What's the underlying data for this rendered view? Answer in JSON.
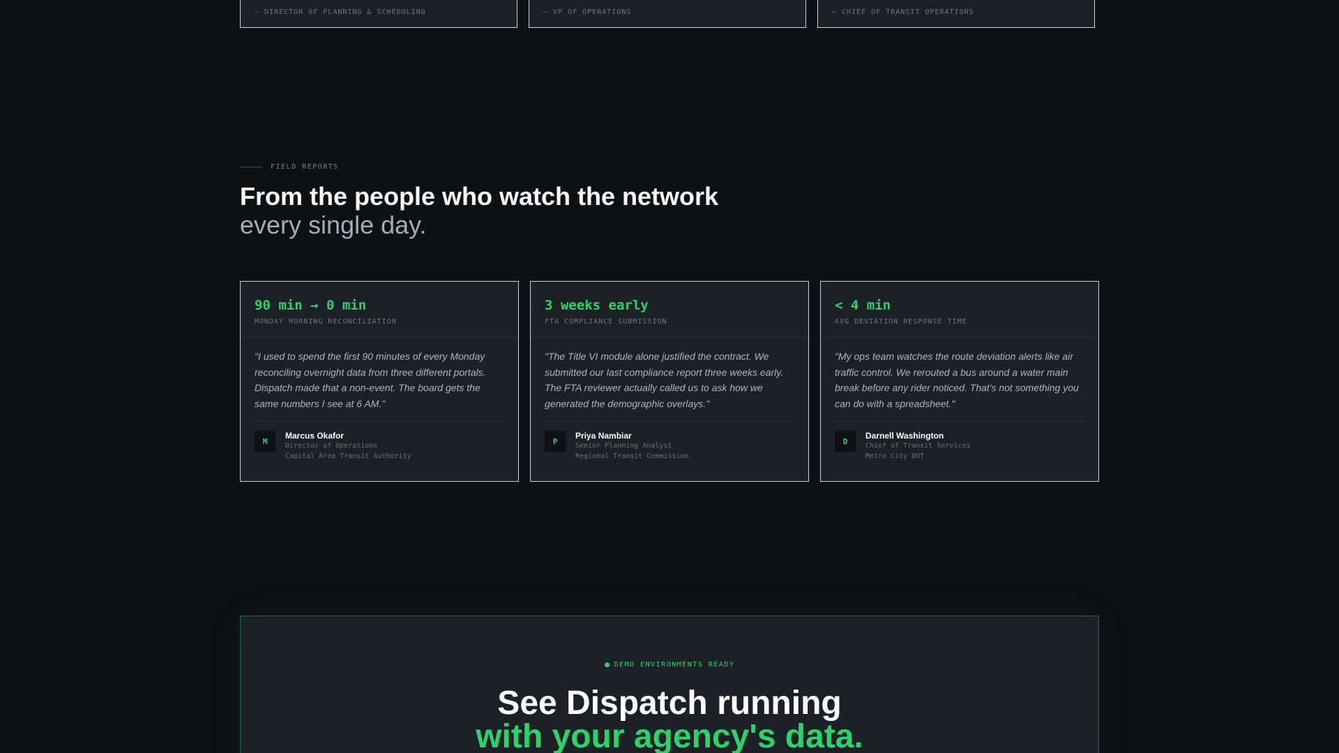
{
  "top_cards": [
    {
      "role": "— DIRECTOR OF PLANNING & SCHEDULING"
    },
    {
      "role": "— VP OF OPERATIONS"
    },
    {
      "role": "— CHIEF OF TRANSIT OPERATIONS"
    }
  ],
  "field_reports": {
    "eyebrow": "FIELD REPORTS",
    "headline": "From the people who watch the network",
    "headline_sub": "every single day.",
    "cards": [
      {
        "metric": "90 min → 0 min",
        "metric_label": "MONDAY MORNING RECONCILIATION",
        "quote": "\"I used to spend the first 90 minutes of every Monday reconciling overnight data from three different portals. Dispatch made that a non-event. The board gets the same numbers I see at 6 AM.\"",
        "avatar_initial": "M",
        "name": "Marcus Okafor",
        "title": "Director of Operations",
        "org": "Capital Area Transit Authority"
      },
      {
        "metric": "3 weeks early",
        "metric_label": "FTA COMPLIANCE SUBMISSION",
        "quote": "\"The Title VI module alone justified the contract. We submitted our last compliance report three weeks early. The FTA reviewer actually called us to ask how we generated the demographic overlays.\"",
        "avatar_initial": "P",
        "name": "Priya Nambiar",
        "title": "Senior Planning Analyst",
        "org": "Regional Transit Commission"
      },
      {
        "metric": "< 4 min",
        "metric_label": "AVG DEVIATION RESPONSE TIME",
        "quote": "\"My ops team watches the route deviation alerts like air traffic control. We rerouted a bus around a water main break before any rider noticed. That's not something you can do with a spreadsheet.\"",
        "avatar_initial": "D",
        "name": "Darnell Washington",
        "title": "Chief of Transit Services",
        "org": "Metro City DOT"
      }
    ]
  },
  "cta": {
    "badge": "DEMO ENVIRONMENTS READY",
    "title": "See Dispatch running",
    "title_accent": "with your agency's data."
  },
  "colors": {
    "background": "#0d1015",
    "card": "#1c2027",
    "accent": "#2bd46a",
    "muted_text": "#a6adb6"
  }
}
